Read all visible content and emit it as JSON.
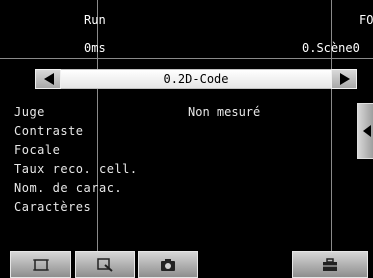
{
  "status": {
    "mode": "Run",
    "mode_right": "FO",
    "time": "0ms",
    "scene_right": "0.Scène0"
  },
  "nav": {
    "scene_label": "0.2D-Code",
    "prev_icon": "left-arrow-icon",
    "next_icon": "right-arrow-icon"
  },
  "results": [
    {
      "label": "Juge",
      "value": "Non mesuré"
    },
    {
      "label": "Contraste",
      "value": ""
    },
    {
      "label": "Focale",
      "value": ""
    },
    {
      "label": "Taux reco. cell.",
      "value": ""
    },
    {
      "label": "Nom. de carac.",
      "value": ""
    },
    {
      "label": "Caractères",
      "value": ""
    }
  ],
  "toolbar": {
    "icons": [
      "frame-icon",
      "zoom-icon",
      "camera-icon",
      "toolbox-icon"
    ],
    "side_icon": "chevron-left-icon"
  },
  "colors": {
    "background": "#000000",
    "button_light": "#d9d9d9",
    "button_dark": "#8e8e8e"
  }
}
